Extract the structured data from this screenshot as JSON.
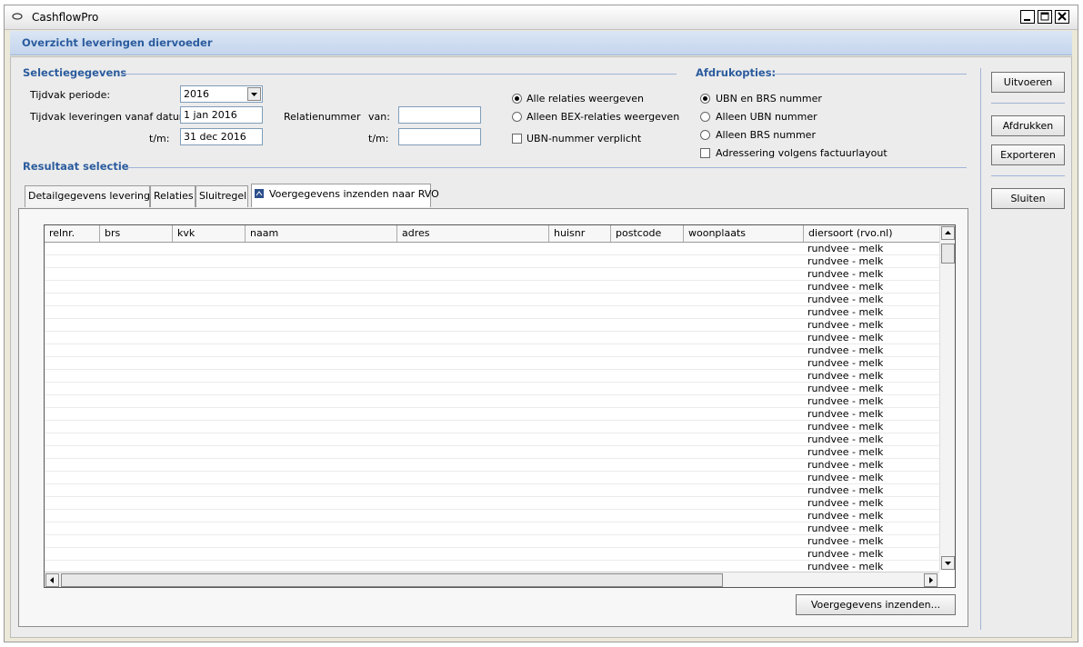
{
  "window": {
    "title": "CashflowPro"
  },
  "subheader": {
    "title": "Overzicht leveringen diervoeder"
  },
  "selection": {
    "section_title": "Selectiegegevens",
    "period_label": "Tijdvak periode:",
    "period_value": "2016",
    "from_date_label": "Tijdvak leveringen vanaf datum:",
    "from_date_value": "1 jan 2016",
    "to_date_label": "t/m:",
    "to_date_value": "31 dec 2016",
    "relation_label": "Relatienummer",
    "rel_from_label": "van:",
    "rel_from_value": "",
    "rel_to_label": "t/m:",
    "rel_to_value": "",
    "radio_all": "Alle relaties weergeven",
    "radio_bex": "Alleen BEX-relaties weergeven",
    "checkbox_ubn": "UBN-nummer verplicht"
  },
  "print_options": {
    "section_title": "Afdrukopties:",
    "radio_ubn_brs": "UBN en BRS nummer",
    "radio_ubn": "Alleen UBN nummer",
    "radio_brs": "Alleen BRS nummer",
    "checkbox_address": "Adressering volgens factuurlayout"
  },
  "result": {
    "section_title": "Resultaat selectie",
    "tabs": [
      "Detailgegevens leveringen",
      "Relaties",
      "Sluitregel",
      "Voergegevens inzenden naar RVO"
    ],
    "active_tab": 3,
    "columns": [
      "relnr.",
      "brs",
      "kvk",
      "naam",
      "adres",
      "huisnr",
      "postcode",
      "woonplaats",
      "diersoort (rvo.nl)"
    ],
    "rows": [
      "rundvee - melk",
      "rundvee - melk",
      "rundvee - melk",
      "rundvee - melk",
      "rundvee - melk",
      "rundvee - melk",
      "rundvee - melk",
      "rundvee - melk",
      "rundvee - melk",
      "rundvee - melk",
      "rundvee - melk",
      "rundvee - melk",
      "rundvee - melk",
      "rundvee - melk",
      "rundvee - melk",
      "rundvee - melk",
      "rundvee - melk",
      "rundvee - melk",
      "rundvee - melk",
      "rundvee - melk",
      "rundvee - melk",
      "rundvee - melk",
      "rundvee - melk",
      "rundvee - melk",
      "rundvee - melk",
      "rundvee - melk"
    ],
    "submit_button": "Voergegevens inzenden..."
  },
  "side_buttons": {
    "run": "Uitvoeren",
    "print": "Afdrukken",
    "export": "Exporteren",
    "close": "Sluiten"
  }
}
